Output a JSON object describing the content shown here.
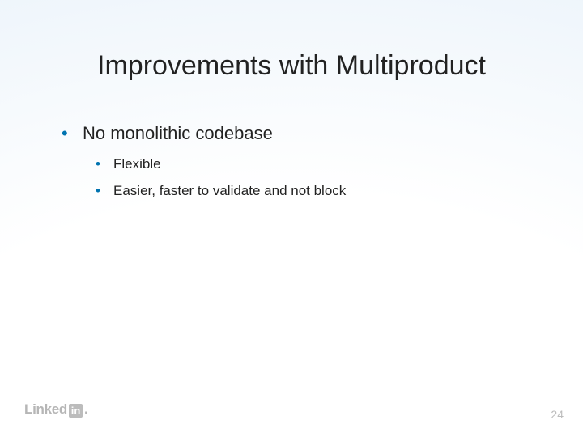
{
  "title": "Improvements with Multiproduct",
  "bullets": {
    "item0": {
      "text": "No monolithic codebase",
      "sub": {
        "s0": "Flexible",
        "s1": "Easier, faster to validate and not block"
      }
    }
  },
  "logo": {
    "word": "Linked",
    "box": "in",
    "trail": "."
  },
  "page_number": "24"
}
